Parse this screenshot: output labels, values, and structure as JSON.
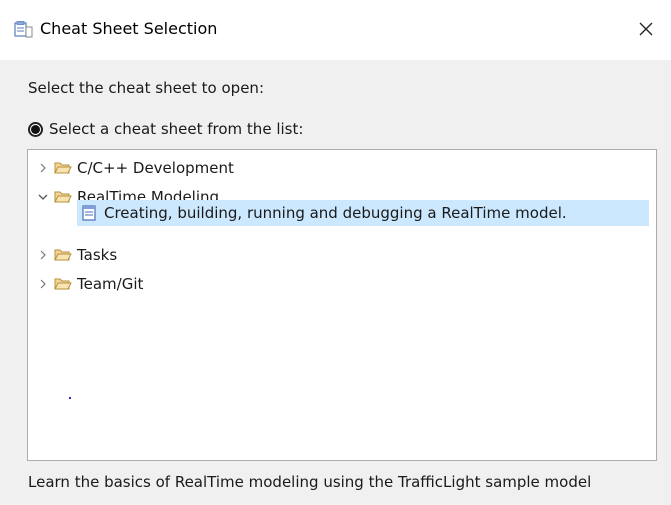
{
  "window": {
    "title": "Cheat Sheet Selection"
  },
  "prompt": "Select the cheat sheet to open:",
  "radio": {
    "label": "Select a cheat sheet from the list:",
    "selected": true
  },
  "tree": {
    "items": [
      {
        "label": "C/C++ Development",
        "expanded": false
      },
      {
        "label": "RealTime Modeling",
        "expanded": true,
        "children": [
          {
            "label": "Creating, building, running and debugging a RealTime model.",
            "selected": true
          }
        ]
      },
      {
        "label": "Tasks",
        "expanded": false
      },
      {
        "label": "Team/Git",
        "expanded": false
      }
    ]
  },
  "description": "Learn the basics of RealTime modeling using the TrafficLight sample model",
  "colors": {
    "selection": "#cce8ff",
    "folder": "#dcb67a"
  }
}
